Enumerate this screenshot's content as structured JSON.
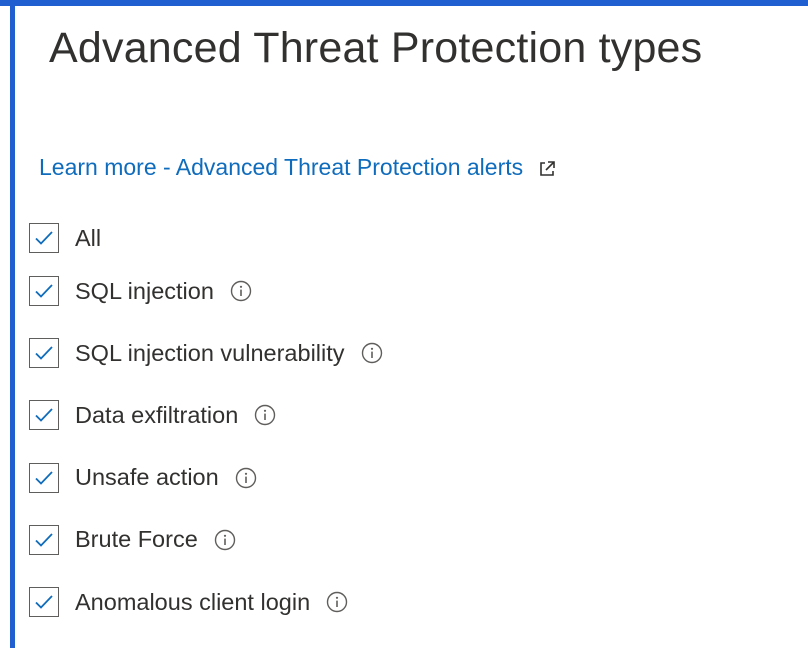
{
  "panel": {
    "title": "Advanced Threat Protection types",
    "learn_more": {
      "label": "Learn more - Advanced Threat Protection alerts",
      "icon": "external-link-icon"
    }
  },
  "options": [
    {
      "label": "All",
      "checked": true,
      "info": false
    },
    {
      "label": "SQL injection",
      "checked": true,
      "info": true
    },
    {
      "label": "SQL injection vulnerability",
      "checked": true,
      "info": true
    },
    {
      "label": "Data exfiltration",
      "checked": true,
      "info": true
    },
    {
      "label": "Unsafe action",
      "checked": true,
      "info": true
    },
    {
      "label": "Brute Force",
      "checked": true,
      "info": true
    },
    {
      "label": "Anomalous client login",
      "checked": true,
      "info": true
    }
  ],
  "colors": {
    "accent": "#1f5fd0",
    "link": "#0f6cbd",
    "checkmark": "#0f6cbd",
    "text": "#323130"
  }
}
